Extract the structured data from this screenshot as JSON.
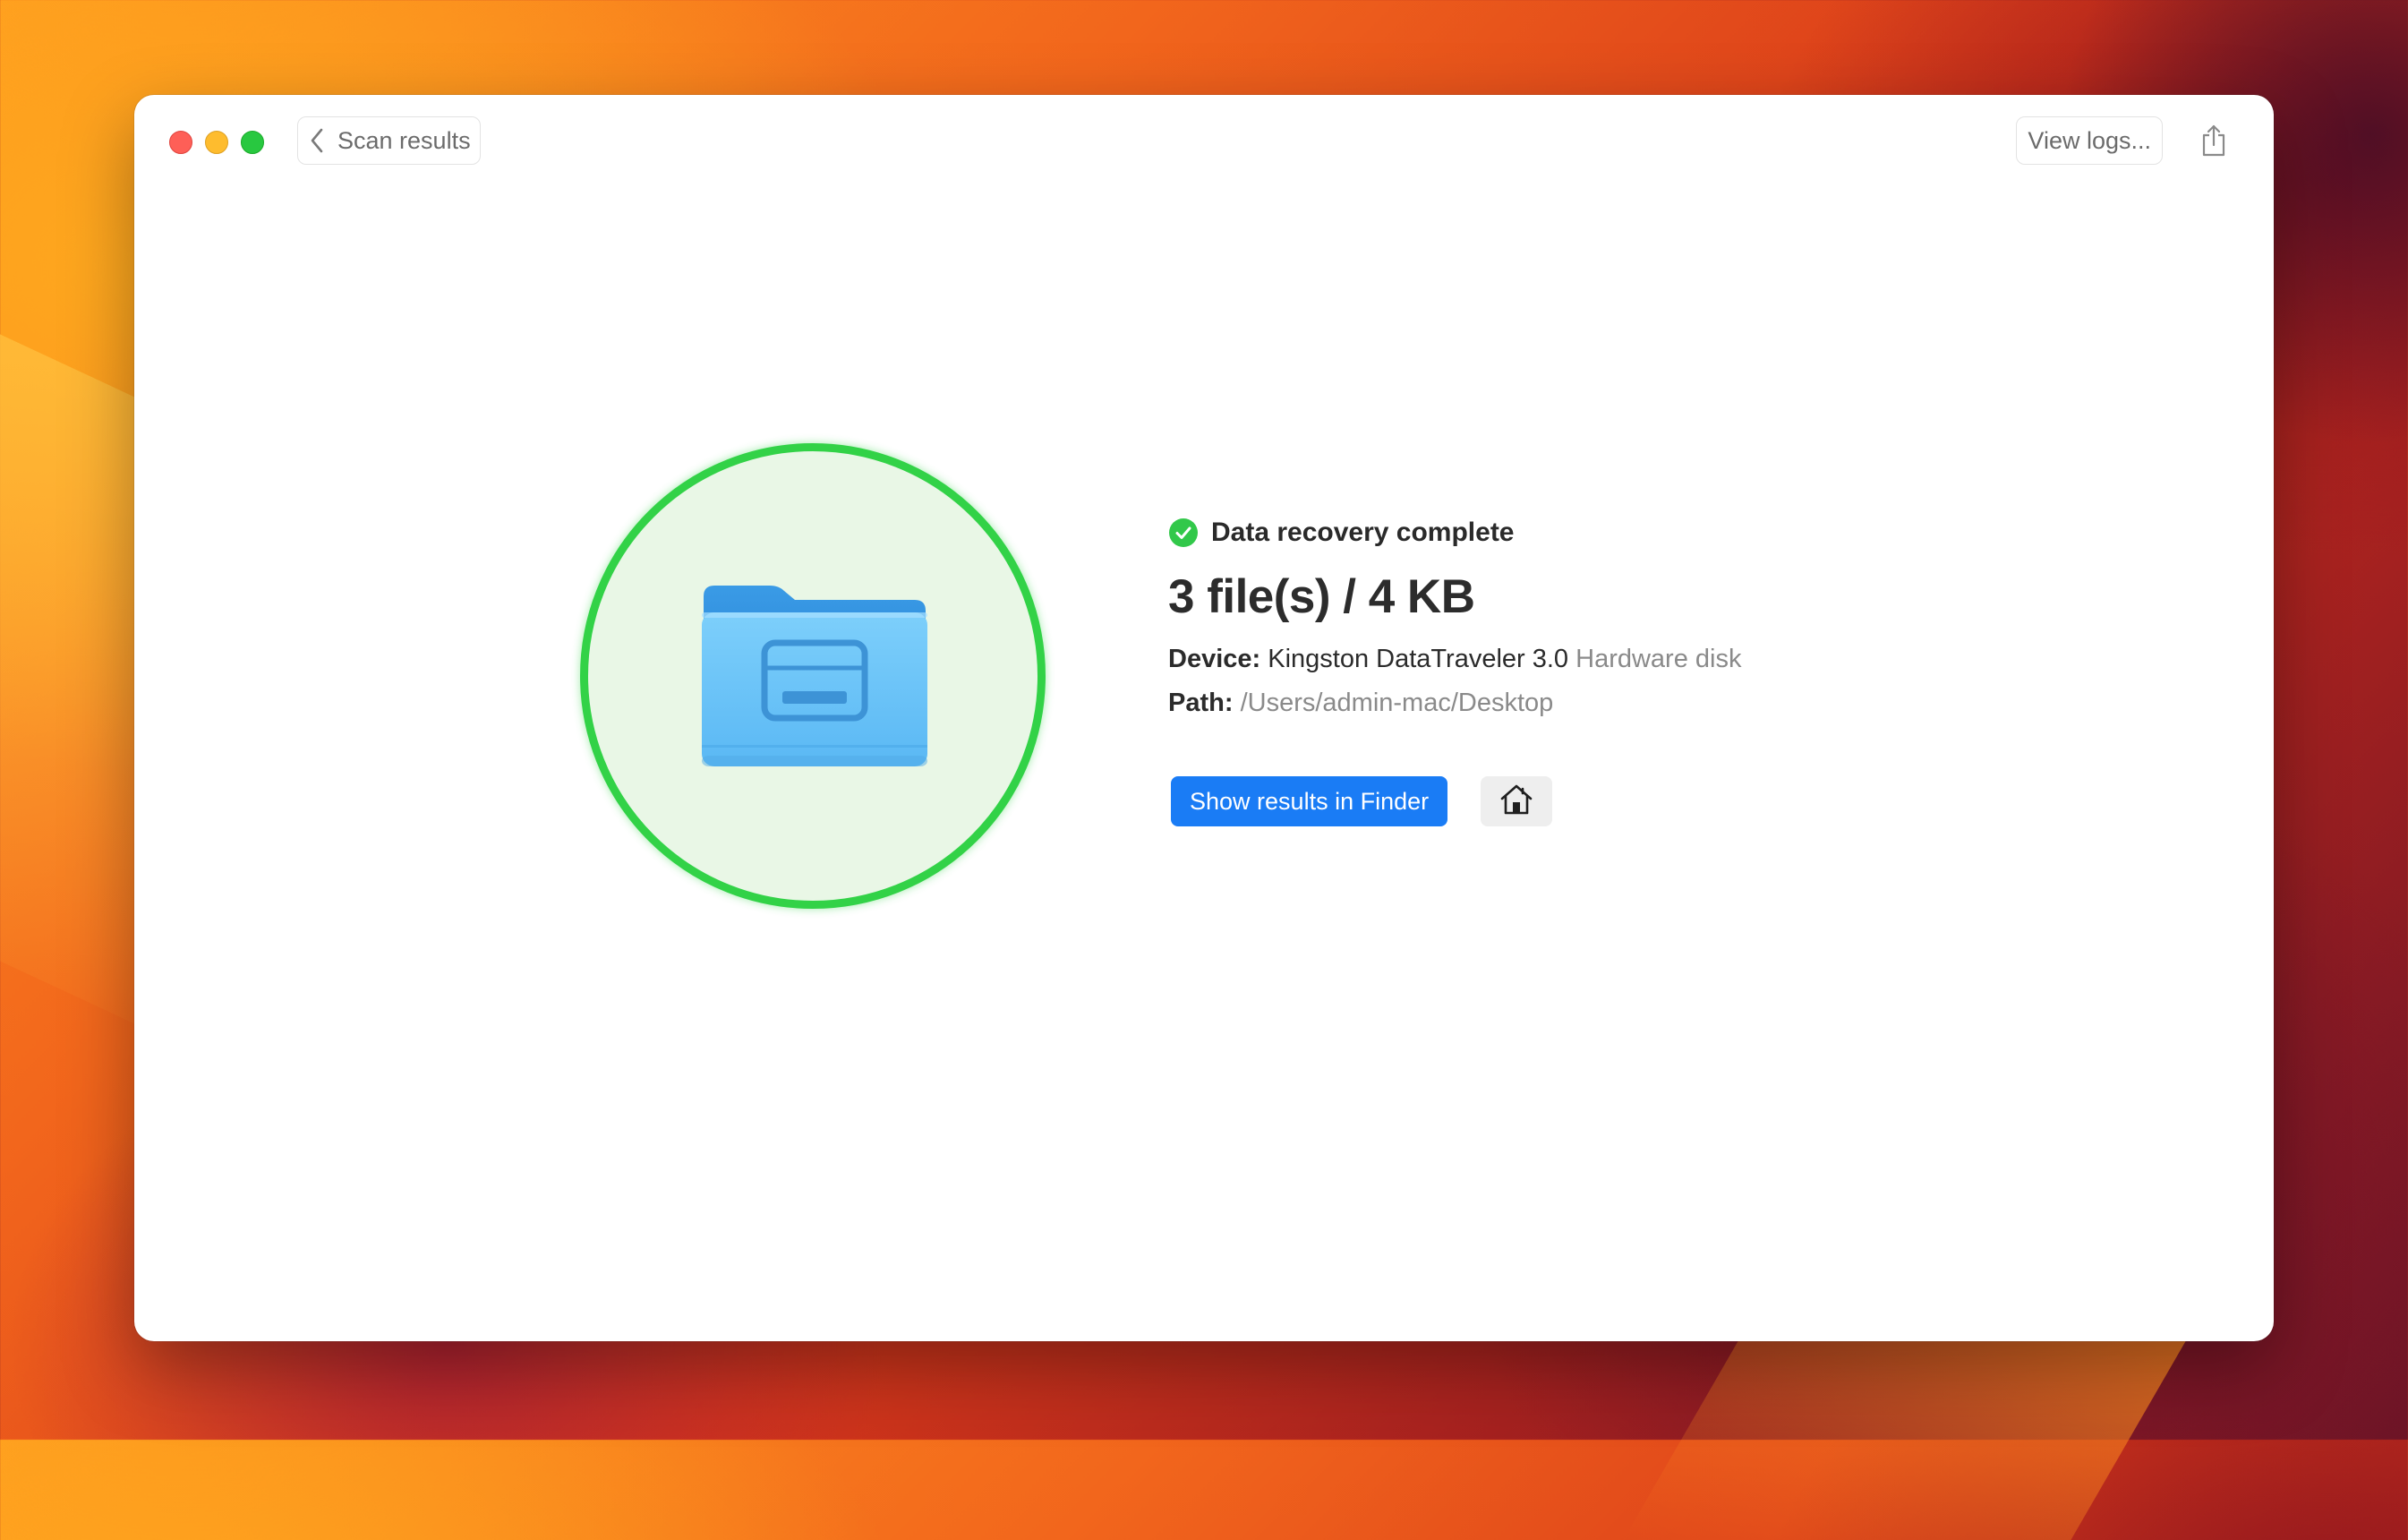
{
  "titlebar": {
    "back_label": "Scan results",
    "logs_label": "View logs...",
    "share_icon": "share-icon"
  },
  "result": {
    "status_text": "Data recovery complete",
    "status_color": "#32d247",
    "headline": "3 file(s) / 4 KB",
    "device_label": "Device:",
    "device_name": "Kingston DataTraveler 3.0",
    "device_type": "Hardware disk",
    "path_label": "Path:",
    "path_value": "/Users/admin-mac/Desktop"
  },
  "actions": {
    "finder_label": "Show results in Finder",
    "finder_color": "#1a7cf5",
    "home_icon": "home-icon"
  },
  "hero": {
    "icon": "folder-icon",
    "ring_color": "#32d247"
  }
}
